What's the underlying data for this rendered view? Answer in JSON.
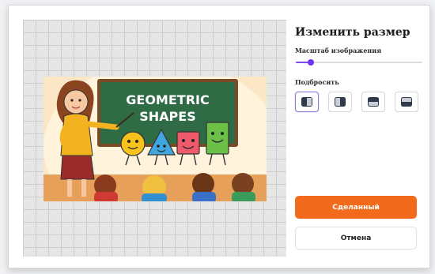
{
  "dialog": {
    "title": "Изменить размер",
    "scale_label": "Масштаб изображения",
    "scale_value": 0.12,
    "flip_label": "Подбросить",
    "flip_options": [
      {
        "icon": "split-left-dark-icon",
        "selected": true
      },
      {
        "icon": "split-right-dark-icon",
        "selected": false
      },
      {
        "icon": "split-top-dark-icon",
        "selected": false
      },
      {
        "icon": "split-bottom-dark-icon",
        "selected": false
      }
    ],
    "done_label": "Сделанный",
    "cancel_label": "Отмена"
  },
  "image": {
    "heading_line1": "GEOMETRIC",
    "heading_line2": "SHAPES"
  },
  "colors": {
    "accent": "#f26a1b",
    "slider": "#7b4df2",
    "board": "#2f6b45"
  }
}
